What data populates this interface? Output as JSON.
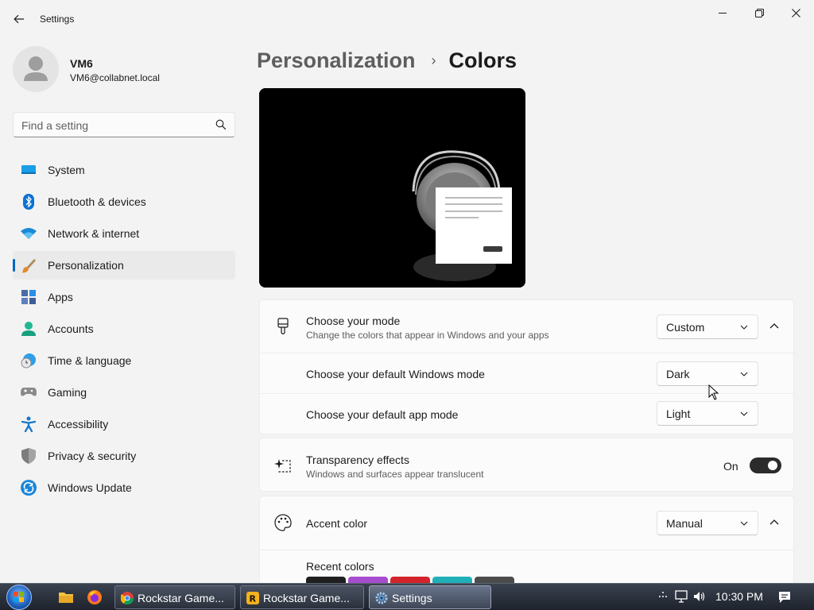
{
  "window": {
    "title": "Settings",
    "back_icon": "back-arrow-icon",
    "controls": [
      "minimize-icon",
      "restore-icon",
      "close-icon"
    ]
  },
  "profile": {
    "name": "VM6",
    "email": "VM6@collabnet.local"
  },
  "search": {
    "placeholder": "Find a setting",
    "value": ""
  },
  "sidebar": {
    "items": [
      {
        "label": "System",
        "icon": "system-icon",
        "active": false
      },
      {
        "label": "Bluetooth & devices",
        "icon": "bluetooth-icon",
        "active": false
      },
      {
        "label": "Network & internet",
        "icon": "wifi-icon",
        "active": false
      },
      {
        "label": "Personalization",
        "icon": "brush-icon",
        "active": true
      },
      {
        "label": "Apps",
        "icon": "apps-icon",
        "active": false
      },
      {
        "label": "Accounts",
        "icon": "accounts-icon",
        "active": false
      },
      {
        "label": "Time & language",
        "icon": "clock-globe-icon",
        "active": false
      },
      {
        "label": "Gaming",
        "icon": "gamepad-icon",
        "active": false
      },
      {
        "label": "Accessibility",
        "icon": "accessibility-icon",
        "active": false
      },
      {
        "label": "Privacy & security",
        "icon": "shield-icon",
        "active": false
      },
      {
        "label": "Windows Update",
        "icon": "update-icon",
        "active": false
      }
    ]
  },
  "breadcrumb": {
    "parent": "Personalization",
    "separator": "›",
    "current": "Colors"
  },
  "mode_card": {
    "title": "Choose your mode",
    "description": "Change the colors that appear in Windows and your apps",
    "value": "Custom",
    "windows_mode_label": "Choose your default Windows mode",
    "windows_mode_value": "Dark",
    "app_mode_label": "Choose your default app mode",
    "app_mode_value": "Light"
  },
  "transparency": {
    "title": "Transparency effects",
    "description": "Windows and surfaces appear translucent",
    "state": "On"
  },
  "accent": {
    "title": "Accent color",
    "value": "Manual",
    "recent_label": "Recent colors",
    "recent_colors": [
      "#1f1f1f",
      "#a64ccf",
      "#d2242a",
      "#1fb0b8",
      "#4c4c4c"
    ]
  },
  "colors": {
    "accent": "#0067c0",
    "window_bg": "#f3f3f3",
    "card_bg": "#fbfbfb",
    "toggle_on": "#2b2b2b"
  },
  "taskbar": {
    "tasks": [
      {
        "label": "Rockstar Game...",
        "icon": "chrome-icon",
        "active": false
      },
      {
        "label": "Rockstar Game...",
        "icon": "rockstar-icon",
        "active": false
      },
      {
        "label": "Settings",
        "icon": "gear-icon",
        "active": true
      }
    ],
    "time": "10:30 PM"
  }
}
